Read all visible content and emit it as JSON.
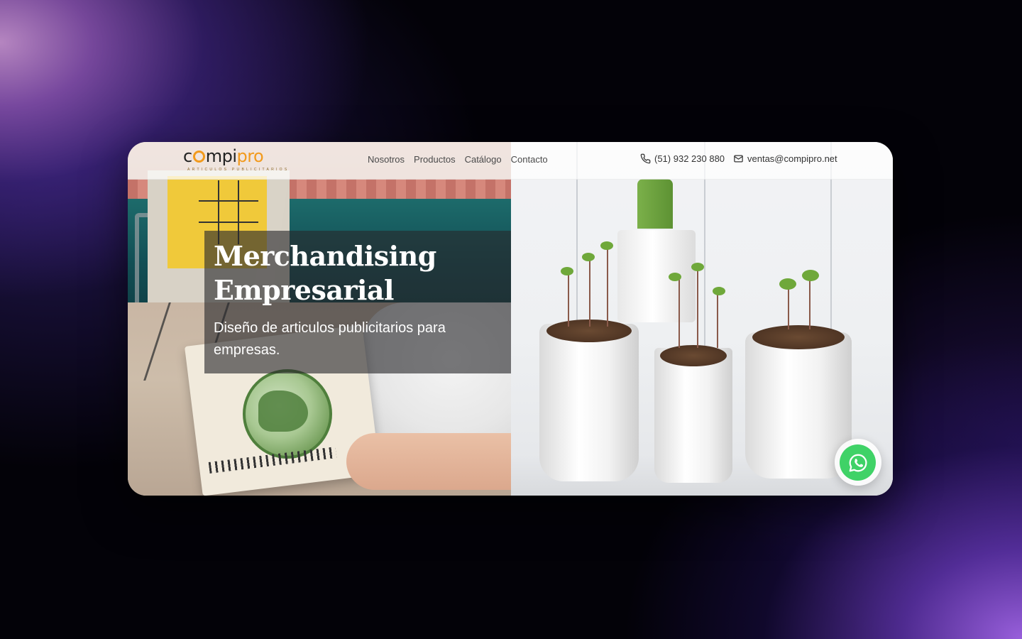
{
  "brand": {
    "logo_prefix": "c",
    "logo_middle": "mpi",
    "logo_suffix": "pro",
    "tagline": "ARTICULOS PUBLICITARIOS",
    "accent_color": "#f29a1d"
  },
  "nav": {
    "items": [
      {
        "label": "Nosotros"
      },
      {
        "label": "Productos"
      },
      {
        "label": "Catálogo"
      },
      {
        "label": "Contacto"
      }
    ]
  },
  "contact": {
    "phone": "(51) 932 230 880",
    "phone_icon": "phone-icon",
    "email": "ventas@compipro.net",
    "email_icon": "mail-icon"
  },
  "hero": {
    "title_line_1": "Merchandising",
    "title_line_2": "Empresarial",
    "subtitle": "Diseño de articulos publicitarios para empresas."
  },
  "floating": {
    "whatsapp_icon": "whatsapp-icon",
    "whatsapp_color": "#3fd267"
  }
}
